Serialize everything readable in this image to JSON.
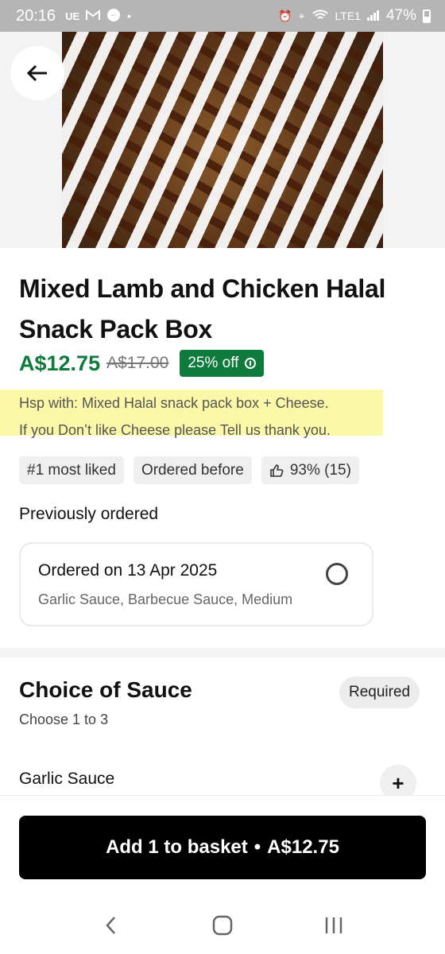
{
  "status_bar": {
    "time": "20:16",
    "left_icons": [
      "UE",
      "gmail-icon",
      "messenger-icon",
      "dot-icon"
    ],
    "network": "LTE1",
    "battery": "47%"
  },
  "item": {
    "title": "Mixed Lamb and Chicken Halal Snack Pack Box",
    "price": "A$12.75",
    "original_price": "A$17.00",
    "discount": "25% off",
    "description_lines": [
      "Hsp with: Mixed Halal snack pack box + Cheese.",
      "If you Don’t like Cheese please Tell us thank you."
    ],
    "chips": [
      "#1 most liked",
      "Ordered before",
      "93% (15)"
    ]
  },
  "previous_order": {
    "label": "Previously ordered",
    "title": "Ordered on 13 Apr 2025",
    "details": "Garlic Sauce, Barbecue Sauce, Medium"
  },
  "sauce_section": {
    "title": "Choice of Sauce",
    "subtitle": "Choose 1 to 3",
    "required_label": "Required",
    "options": [
      "Garlic Sauce"
    ]
  },
  "cta": {
    "label": "Add 1 to basket",
    "separator": "•",
    "price": "A$12.75"
  },
  "colors": {
    "accent_green": "#0e7a3b",
    "highlight": "#fbf8a8",
    "button": "#000000"
  }
}
